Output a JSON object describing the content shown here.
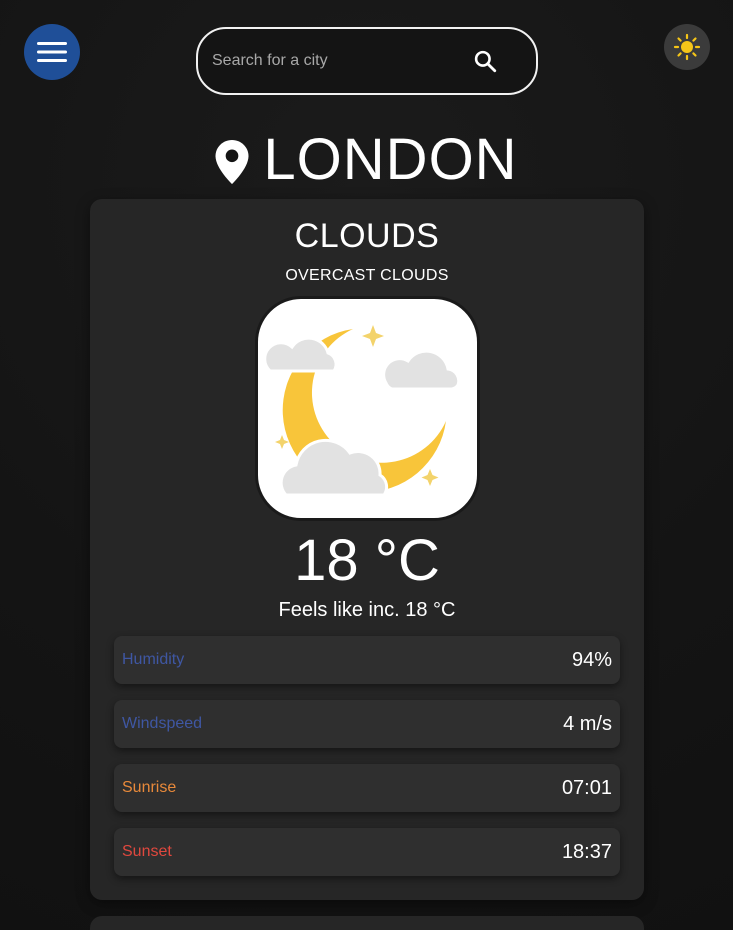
{
  "search": {
    "placeholder": "Search for a city"
  },
  "icons": {
    "menu": "hamburger-menu-icon",
    "search": "search-icon",
    "theme": "sun-icon",
    "location": "location-pin-icon",
    "weather": "moon-clouds-icon"
  },
  "location": {
    "city": "LONDON"
  },
  "weather": {
    "main": "CLOUDS",
    "description": "OVERCAST CLOUDS",
    "temperature": "18 °C",
    "feels_like": "Feels like inc. 18 °C"
  },
  "stats": [
    {
      "label": "Humidity",
      "value": "94%",
      "color": "#3f57a3"
    },
    {
      "label": "Windspeed",
      "value": "4 m/s",
      "color": "#3f57a3"
    },
    {
      "label": "Sunrise",
      "value": "07:01",
      "color": "#e8893a"
    },
    {
      "label": "Sunset",
      "value": "18:37",
      "color": "#e0483e"
    }
  ],
  "colors": {
    "background": "#141414",
    "card": "#262626",
    "menu_button": "#1f4f98",
    "theme_button": "#3b3b3b",
    "sun": "#f5c518",
    "moon": "#f8c53a"
  }
}
